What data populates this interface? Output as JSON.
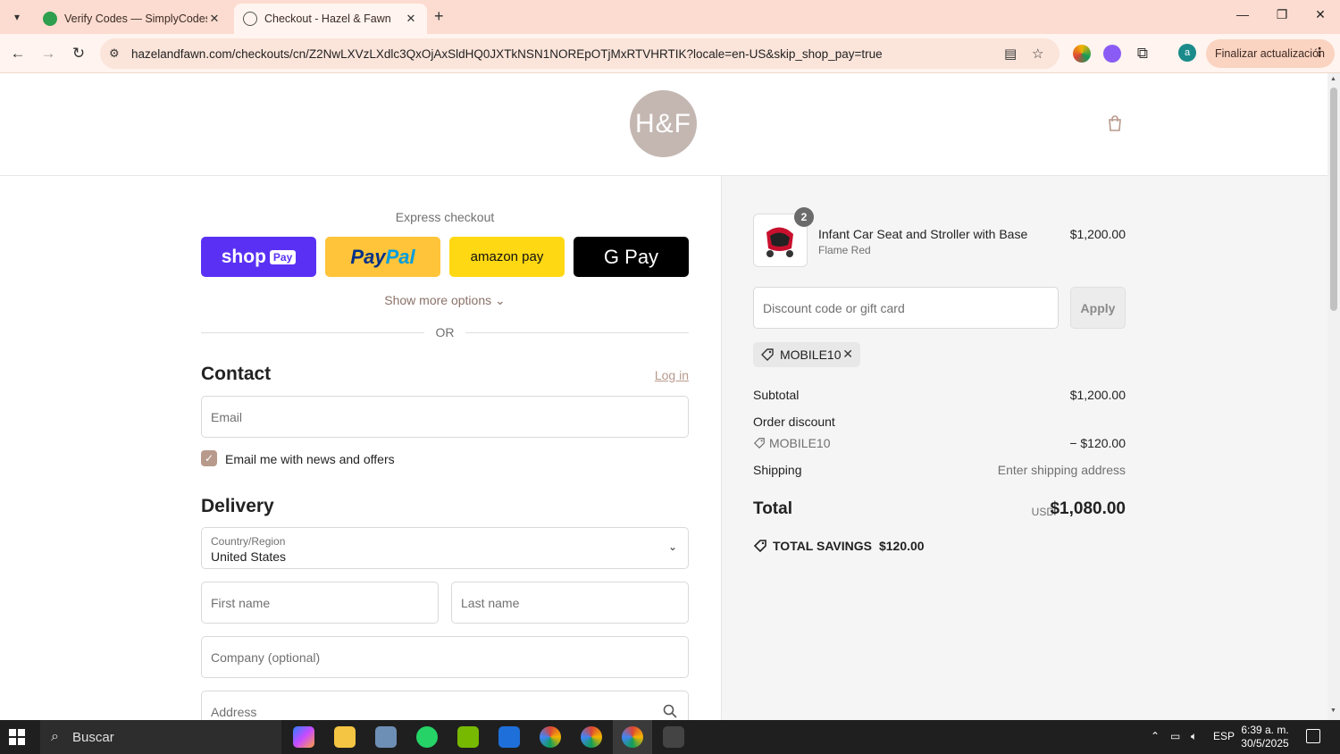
{
  "browser": {
    "tabs": [
      {
        "title": "Verify Codes — SimplyCodes",
        "active": false
      },
      {
        "title": "Checkout - Hazel & Fawn",
        "active": true
      }
    ],
    "url": "hazelandfawn.com/checkouts/cn/Z2NwLXVzLXdlc3QxOjAxSldHQ0JXTkNSN1NOREpOTjMxRTVHRTIK?locale=en-US&skip_shop_pay=true",
    "update_label": "Finalizar actualización",
    "profile_initial": "a"
  },
  "header": {
    "logo_text": "H&F"
  },
  "express": {
    "title": "Express checkout",
    "shop_label": "shop",
    "shop_pay_chip": "Pay",
    "paypal_label_1": "Pay",
    "paypal_label_2": "Pal",
    "amazon_label": "amazon pay",
    "gpay_label": "G Pay",
    "show_more": "Show more options",
    "or_text": "OR"
  },
  "contact": {
    "title": "Contact",
    "login": "Log in",
    "email_placeholder": "Email",
    "newsletter_label": "Email me with news and offers"
  },
  "delivery": {
    "title": "Delivery",
    "country_label": "Country/Region",
    "country_value": "United States",
    "first_name": "First name",
    "last_name": "Last name",
    "company": "Company (optional)",
    "address": "Address"
  },
  "summary": {
    "product": {
      "name": "Infant Car Seat and Stroller with Base",
      "variant": "Flame Red",
      "price": "$1,200.00",
      "quantity": "2"
    },
    "discount_placeholder": "Discount code or gift card",
    "apply_label": "Apply",
    "applied_code": "MOBILE10",
    "subtotal_label": "Subtotal",
    "subtotal_value": "$1,200.00",
    "order_discount_label": "Order discount",
    "discount_code": "MOBILE10",
    "discount_value": "− $120.00",
    "shipping_label": "Shipping",
    "shipping_value": "Enter shipping address",
    "total_label": "Total",
    "currency": "USD",
    "total_value": "$1,080.00",
    "savings_label": "TOTAL SAVINGS",
    "savings_value": "$120.00"
  },
  "taskbar": {
    "search_text": "Buscar",
    "language": "ESP",
    "time": "6:39 a. m.",
    "date": "30/5/2025"
  },
  "colors": {
    "accent": "#b89a8c",
    "shop_pay": "#5a31f4",
    "paypal": "#ffc439",
    "amazon_pay": "#ffd814"
  }
}
